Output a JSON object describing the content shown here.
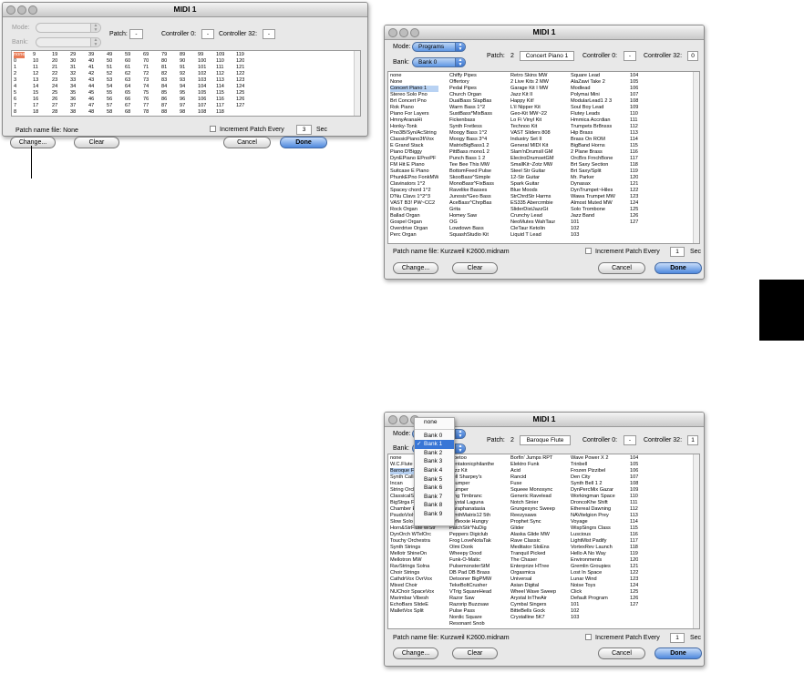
{
  "d1": {
    "title": "MIDI 1",
    "mode_label": "Mode:",
    "bank_label": "Bank:",
    "patch_label": "Patch:",
    "patch_value": "-",
    "c0_label": "Controller 0:",
    "c0_value": "-",
    "c32_label": "Controller 32:",
    "c32_value": "-",
    "columns": [
      [
        "none",
        "0",
        "1",
        "2",
        "3",
        "4",
        "5",
        "6",
        "7",
        "8"
      ],
      [
        "9",
        "10",
        "11",
        "12",
        "13",
        "14",
        "15",
        "16",
        "17",
        "18"
      ],
      [
        "19",
        "20",
        "21",
        "22",
        "23",
        "24",
        "25",
        "26",
        "27",
        "28"
      ],
      [
        "29",
        "30",
        "31",
        "32",
        "33",
        "34",
        "35",
        "36",
        "37",
        "38"
      ],
      [
        "39",
        "40",
        "41",
        "42",
        "43",
        "44",
        "45",
        "46",
        "47",
        "48"
      ],
      [
        "49",
        "50",
        "51",
        "52",
        "53",
        "54",
        "55",
        "56",
        "57",
        "58"
      ],
      [
        "59",
        "60",
        "61",
        "62",
        "63",
        "64",
        "65",
        "66",
        "67",
        "68"
      ],
      [
        "69",
        "70",
        "71",
        "72",
        "73",
        "74",
        "75",
        "76",
        "77",
        "78"
      ],
      [
        "79",
        "80",
        "81",
        "82",
        "83",
        "84",
        "85",
        "86",
        "87",
        "88"
      ],
      [
        "89",
        "90",
        "91",
        "92",
        "93",
        "94",
        "95",
        "96",
        "97",
        "98"
      ],
      [
        "99",
        "100",
        "101",
        "102",
        "103",
        "104",
        "105",
        "106",
        "107",
        "108"
      ],
      [
        "109",
        "110",
        "111",
        "112",
        "113",
        "114",
        "115",
        "116",
        "117",
        "118"
      ],
      [
        "119",
        "120",
        "121",
        "122",
        "123",
        "124",
        "125",
        "126",
        "127"
      ]
    ],
    "patch_file": "Patch name file: None",
    "increment": "Increment Patch Every",
    "inc_value": "3",
    "sec": "Sec",
    "change": "Change...",
    "clear": "Clear",
    "cancel": "Cancel",
    "done": "Done"
  },
  "d2": {
    "title": "MIDI 1",
    "mode_label": "Mode:",
    "mode_value": "Programs",
    "bank_label": "Bank:",
    "bank_value": "Bank 0",
    "patch_label": "Patch:",
    "patch_num": "2",
    "patch_name": "Concert Piano 1",
    "c0_label": "Controller 0:",
    "c0_value": "-",
    "c32_label": "Controller 32:",
    "c32_value": "0",
    "columns": [
      [
        "none",
        "None",
        "Concert Piano 1",
        "Stereo Solo Pno",
        "Brt Concert Pno",
        "Rok Piano",
        "Piano For Layers",
        "HmnyAranaHi",
        "Honky-Tonk",
        "Pno3B/Syn/AcString",
        "ClassicPiano3f/Vox",
        "E Grand Stack",
        "Piano D'Biggy",
        "DynEPiano EPnoPF",
        "FM Hit E Piano",
        "Suitcase E Piano",
        "PhunkEPno FonkMW",
        "Clavinators 1^2",
        "Spacey chord 1^2",
        "D'Nu Clavs 1^2^3",
        "VAST B3! PW~CC2",
        "Rock Organ",
        "Ballad Organ",
        "Gospel Organ",
        "Overdrive Organ",
        "Perc Organ"
      ],
      [
        "Chiffy Pipes",
        "Offertory",
        "Pedal Pipes",
        "Church Organ",
        "DualBass SlapBas",
        "Warm Bass 1^2",
        "SustBass*MixBass",
        "Fickenbass",
        "Synth Fretless",
        "Moogy Bass 1^2",
        "Moogy Bass 3^4",
        "MatrixBigBass1 2",
        "PittBass mono1 2",
        "Punch Bass 1 2",
        "Tee Bee This MW",
        "BottomFeed Pulse",
        "SkooBass^Simple",
        "MonoBass^FixBass",
        "Ravelike Basses",
        "Junosis*Geo Bass",
        "AceBass^ChrpBas",
        "Grita",
        "Homey Saw",
        "OG",
        "Lowdown Bass",
        "SquashStudio Kit"
      ],
      [
        "Retro Skins MW",
        "2 Live Kits 2 MW",
        "Garage Kit I MW",
        "Jazz Kit II",
        "Happy Kit!",
        "L'il Nipper Kit",
        "Geo-Kit MW~22",
        "Lo Fi Vinyl Kit",
        "Technoo Kit",
        "VAST Sliders 808",
        "Industry Set II",
        "General MIDI Kit",
        "Slam'nDrumsll GM",
        "ElectroDrumsetGM",
        "SmallKit~Zotz MW",
        "Steel Str Guitar",
        "12-Str Guitar",
        "Spark Guitar",
        "Blue Moods",
        "StrChrdStr Harms",
        "ES335 Abercrmbie",
        "SliderDistJazzGt",
        "Crunchy Lead",
        "NeoMutes WahTaur",
        "CleTaur Ketolin",
        "Liquid T Lead"
      ],
      [
        "Square Lead",
        "AlaZawi Take 2",
        "Modlead",
        "Polymai Mini",
        "ModularLead1 2 3",
        "Soul Boy Lead",
        "Flutey Leads",
        "Hmmica Accrdian",
        "Trumpets Br8nsss",
        "Hip Brass",
        "Brass On ROM",
        "BigBand Horns",
        "2 Plane Brass",
        "OrcBrs FrnchBone",
        "Brt Saxy Section",
        "Brt Saxy/Split",
        "Mr. Parker",
        "Dynasax",
        "DynTrumpet~Hiles",
        "Wawa Trumpet MW",
        "Almost Muted MW",
        "Solo Trombone",
        "Jazz Band",
        "101",
        "102",
        "103"
      ],
      [
        "104",
        "105",
        "106",
        "107",
        "108",
        "109",
        "110",
        "111",
        "112",
        "113",
        "114",
        "115",
        "116",
        "117",
        "118",
        "119",
        "120",
        "121",
        "122",
        "123",
        "124",
        "125",
        "126",
        "127"
      ]
    ],
    "patch_file": "Patch name file: Kurzweil K2600.midnam",
    "increment": "Increment Patch Every",
    "inc_value": "1",
    "sec": "Sec",
    "change": "Change...",
    "clear": "Clear",
    "cancel": "Cancel",
    "done": "Done"
  },
  "d3": {
    "title": "MIDI 1",
    "mode_label": "Mode:",
    "bank_label": "Bank:",
    "patch_label": "Patch:",
    "patch_num": "2",
    "patch_name": "Baroque Flute",
    "c0_label": "Controller 0:",
    "c0_value": "-",
    "c32_label": "Controller 32:",
    "c32_value": "1",
    "menu_items": [
      "none",
      "Bank 0",
      "Bank 1",
      "Bank 2",
      "Bank 3",
      "Bank 4",
      "Bank 5",
      "Bank 6",
      "Bank 7",
      "Bank 8",
      "Bank 9"
    ],
    "columns": [
      [
        "none",
        "W.C.Flute",
        "Baroque Flute",
        "Synth Calli",
        "Incan",
        "String Orch",
        "ClassicalStr",
        "BigStrga F",
        "Chamber Ens",
        "PsudoViol~2",
        "Slow Solo Cello",
        "Horn&StrFlute w/Str",
        "DynOrch WTelOrc",
        "Touchy Orchestra",
        "Synth Strings",
        "Mellotr ShineOn",
        "Mellotron MW",
        "RavStrings Solna",
        "Choir Strings",
        "CathdrVox OvrVox",
        "Mixed Choir",
        "NUChoir SpaceVox",
        "Marimbar Vibesh",
        "EchoBars SlideE",
        "MalletVox Split"
      ],
      [
        "Vibetoo",
        "Pentatonicphilanthe",
        "Jazz Kit",
        "Bell Sharpey's",
        "Thumper",
        "Plumper",
        "Ping Timbranc",
        "Crystal Laguna",
        "Paraphanatasia",
        "SynthMatrix12 5th",
        "Reflexxie Hungry",
        "PatchStk^NuDig",
        "Peppers Digiclub",
        "Frog LoveNotaTak",
        "Olmi Donk",
        "Wheepy Dood",
        "Funk-O-Matic",
        "PulsemonsterStM",
        "DB Pad DB Brass",
        "Detooner BigPMW",
        "TekeBoltCrusher",
        "VTrig SquareHead",
        "Razor Saw",
        "Razorip Buzzsaw",
        "Pulse Pass",
        "Nordic Square",
        "Resonant Snob"
      ],
      [
        "Borfin' Jumps RPT",
        "Elektro Funk",
        "Acid",
        "Rancid",
        "Fuse",
        "Squeee Monosync",
        "Generic Ravelead",
        "Notch Sinier",
        "Grungesync Sweep",
        "Reezysaws",
        "Prophet Sync",
        "Glider",
        "Alaska Glide MW",
        "Rave Classic",
        "Meditator SloEns",
        "Tranquil Picked",
        "The Chaser",
        "Enterprize HTree",
        "Orgasmica",
        "Universal",
        "Asian Digital",
        "Wheel Wave Sweep",
        "Arystal InTheAir",
        "Cymbal Singers",
        "BitteBells Gock",
        "Crystalline 5K7"
      ],
      [
        "Wave Power X 2",
        "Trinbell",
        "Frozen Pizzibel",
        "Den City",
        "Synth Bell 1 2",
        "DynPercMix Gazar",
        "Workingman Space",
        "DroncoKhe Shift",
        "Ethereal Dawning",
        "NAVitelgion Prey",
        "Voyage",
        "WispSingrs Class",
        "Luscious",
        "LightMist Padify",
        "VortexRev Launch",
        "Hello A No Way",
        "Environments",
        "Gremlin Groupies",
        "Lost In Space",
        "Lunar Wind",
        "Noise Toys",
        "Click",
        "Default Program",
        "101",
        "102",
        "103"
      ],
      [
        "104",
        "105",
        "106",
        "107",
        "108",
        "109",
        "110",
        "111",
        "112",
        "113",
        "114",
        "115",
        "116",
        "117",
        "118",
        "119",
        "120",
        "121",
        "122",
        "123",
        "124",
        "125",
        "126",
        "127"
      ]
    ],
    "patch_file": "Patch name file: Kurzweil K2600.midnam",
    "increment": "Increment Patch Every",
    "inc_value": "1",
    "sec": "Sec",
    "change": "Change...",
    "clear": "Clear",
    "cancel": "Cancel",
    "done": "Done"
  }
}
